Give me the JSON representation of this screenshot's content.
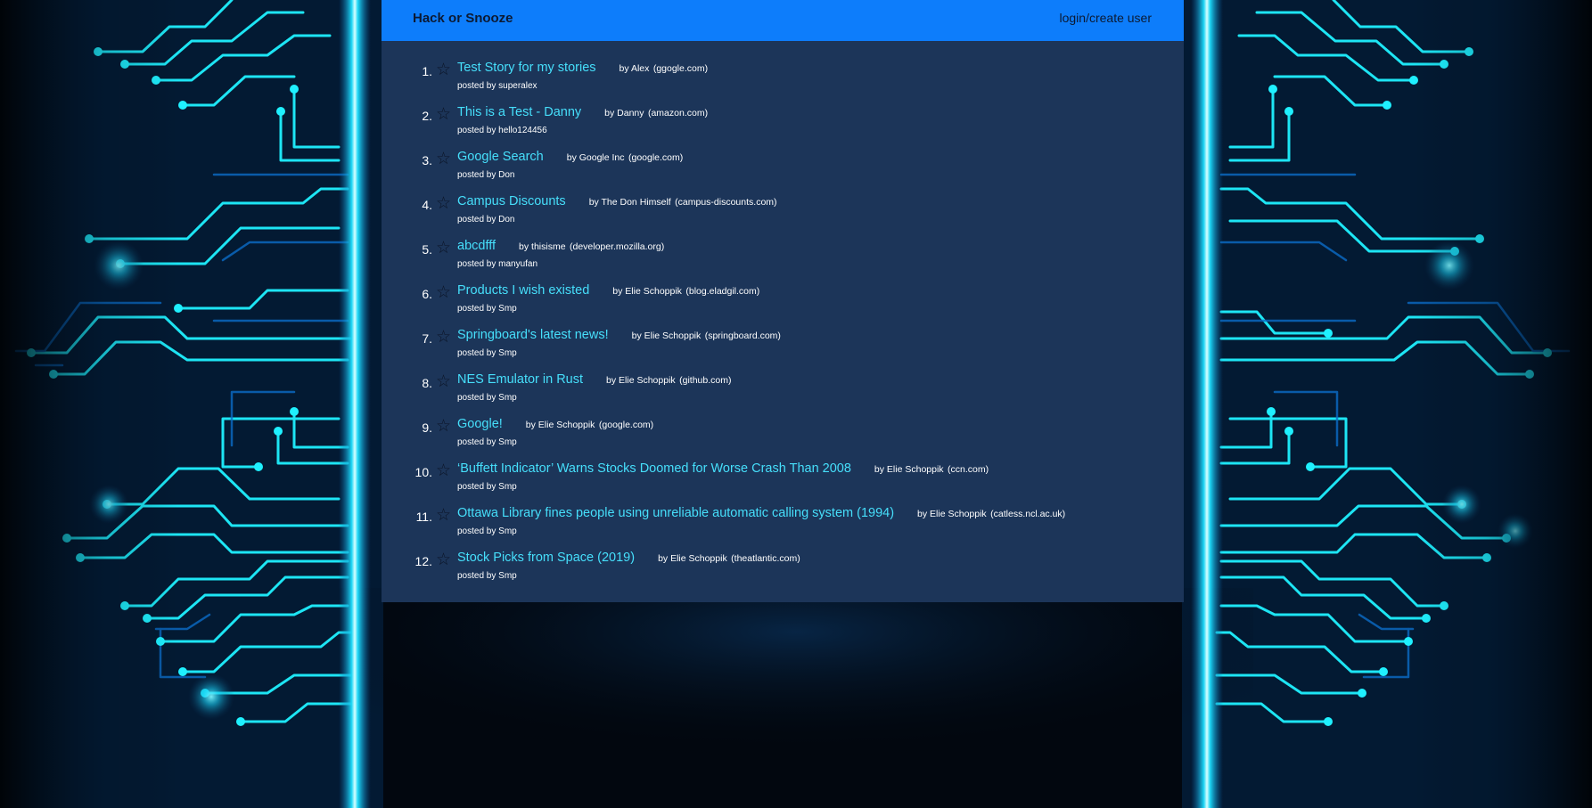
{
  "navbar": {
    "brand": "Hack or Snooze",
    "login": "login/create user"
  },
  "icons": {
    "star": "star-outline-icon"
  },
  "colors": {
    "navbar": "#0d7dfb",
    "panel": "#1c3559",
    "link": "#46dffb",
    "circuit": "#19e2f5"
  },
  "stories": [
    {
      "num": "1.",
      "title": "Test Story for my stories",
      "by": "by Alex",
      "host": "(ggogle.com)",
      "posted": "posted by superalex"
    },
    {
      "num": "2.",
      "title": "This is a Test - Danny",
      "by": "by Danny",
      "host": "(amazon.com)",
      "posted": "posted by hello124456"
    },
    {
      "num": "3.",
      "title": "Google Search",
      "by": "by Google Inc",
      "host": "(google.com)",
      "posted": "posted by Don"
    },
    {
      "num": "4.",
      "title": "Campus Discounts",
      "by": "by The Don Himself",
      "host": "(campus-discounts.com)",
      "posted": "posted by Don"
    },
    {
      "num": "5.",
      "title": "abcdfff",
      "by": "by thisisme",
      "host": "(developer.mozilla.org)",
      "posted": "posted by manyufan"
    },
    {
      "num": "6.",
      "title": "Products I wish existed",
      "by": "by Elie Schoppik",
      "host": "(blog.eladgil.com)",
      "posted": "posted by Smp"
    },
    {
      "num": "7.",
      "title": "Springboard's latest news!",
      "by": "by Elie Schoppik",
      "host": "(springboard.com)",
      "posted": "posted by Smp"
    },
    {
      "num": "8.",
      "title": "NES Emulator in Rust",
      "by": "by Elie Schoppik",
      "host": "(github.com)",
      "posted": "posted by Smp"
    },
    {
      "num": "9.",
      "title": "Google!",
      "by": "by Elie Schoppik",
      "host": "(google.com)",
      "posted": "posted by Smp"
    },
    {
      "num": "10.",
      "title": "‘Buffett Indicator’ Warns Stocks Doomed for Worse Crash Than 2008",
      "by": "by Elie Schoppik",
      "host": "(ccn.com)",
      "posted": "posted by Smp"
    },
    {
      "num": "11.",
      "title": "Ottawa Library fines people using unreliable automatic calling system (1994)",
      "by": "by Elie Schoppik",
      "host": "(catless.ncl.ac.uk)",
      "posted": "posted by Smp"
    },
    {
      "num": "12.",
      "title": "Stock Picks from Space (2019)",
      "by": "by Elie Schoppik",
      "host": "(theatlantic.com)",
      "posted": "posted by Smp"
    }
  ]
}
